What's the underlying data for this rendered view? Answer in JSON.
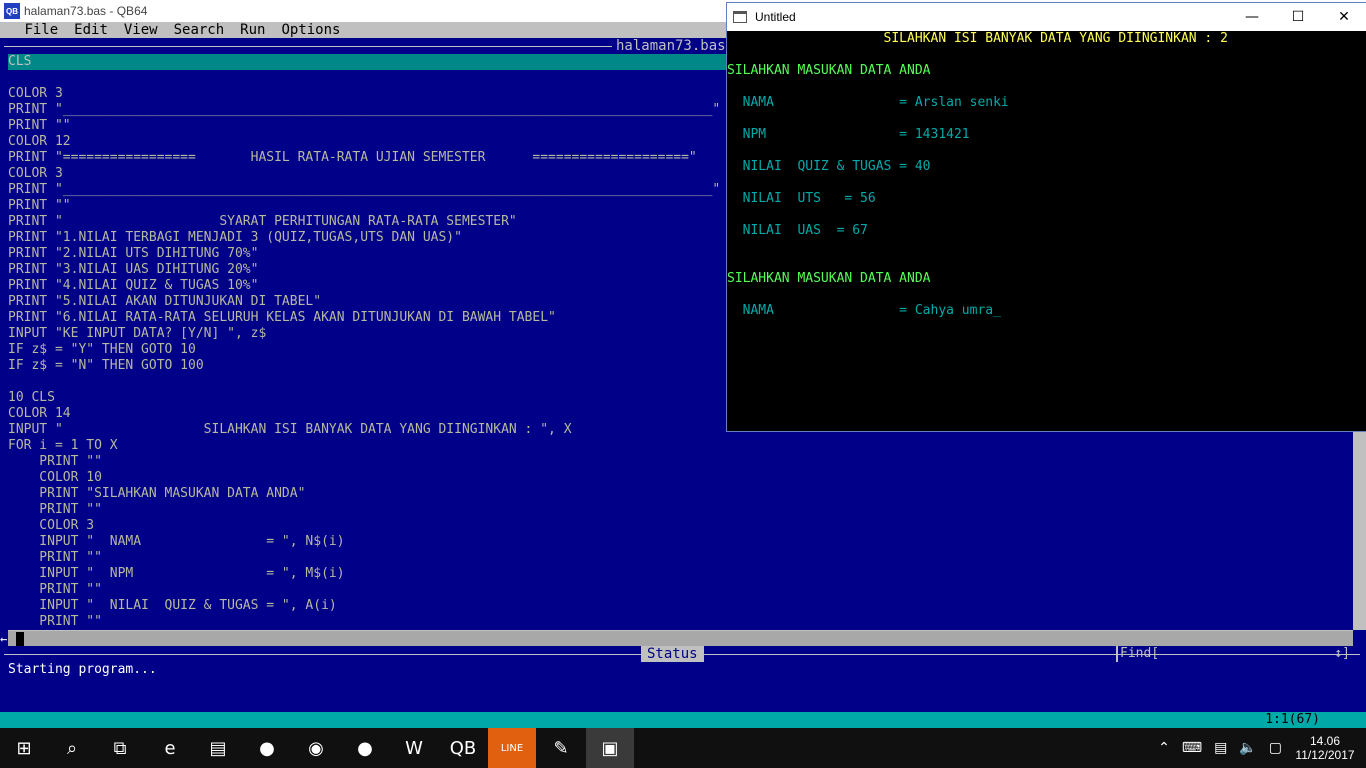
{
  "qb64": {
    "title": "halaman73.bas - QB64",
    "menu": [
      "File",
      "Edit",
      "View",
      "Search",
      "Run",
      "Options"
    ],
    "file_tab": "halaman73.bas*",
    "code_lines": [
      "CLS",
      "",
      "COLOR 3",
      "PRINT \"___________________________________________________________________________________\"",
      "PRINT \"\"",
      "COLOR 12",
      "PRINT \"=================       HASIL RATA-RATA UJIAN SEMESTER      ====================\"",
      "COLOR 3",
      "PRINT \"___________________________________________________________________________________\"",
      "PRINT \"\"",
      "PRINT \"                    SYARAT PERHITUNGAN RATA-RATA SEMESTER\"",
      "PRINT \"1.NILAI TERBAGI MENJADI 3 (QUIZ,TUGAS,UTS DAN UAS)\"",
      "PRINT \"2.NILAI UTS DIHITUNG 70%\"",
      "PRINT \"3.NILAI UAS DIHITUNG 20%\"",
      "PRINT \"4.NILAI QUIZ & TUGAS 10%\"",
      "PRINT \"5.NILAI AKAN DITUNJUKAN DI TABEL\"",
      "PRINT \"6.NILAI RATA-RATA SELURUH KELAS AKAN DITUNJUKAN DI BAWAH TABEL\"",
      "INPUT \"KE INPUT DATA? [Y/N] \", z$",
      "IF z$ = \"Y\" THEN GOTO 10",
      "IF z$ = \"N\" THEN GOTO 100",
      "",
      "10 CLS",
      "COLOR 14",
      "INPUT \"                  SILAHKAN ISI BANYAK DATA YANG DIINGINKAN : \", X",
      "FOR i = 1 TO X",
      "    PRINT \"\"",
      "    COLOR 10",
      "    PRINT \"SILAHKAN MASUKAN DATA ANDA\"",
      "    PRINT \"\"",
      "    COLOR 3",
      "    INPUT \"  NAMA                = \", N$(i)",
      "    PRINT \"\"",
      "    INPUT \"  NPM                 = \", M$(i)",
      "    PRINT \"\"",
      "    INPUT \"  NILAI  QUIZ & TUGAS = \", A(i)",
      "    PRINT \"\""
    ],
    "status_label": "Status",
    "find_label": "Find[",
    "find_end": "↕]",
    "status_message": "Starting program...",
    "cursor_position": "1:1(67)"
  },
  "output_window": {
    "title": "Untitled",
    "lines": [
      {
        "text": "                    SILAHKAN ISI BANYAK DATA YANG DIINGINKAN : 2",
        "color": "c14"
      },
      {
        "text": "",
        "color": "c3"
      },
      {
        "text": "SILAHKAN MASUKAN DATA ANDA",
        "color": "c10"
      },
      {
        "text": "",
        "color": "c3"
      },
      {
        "text": "  NAMA                = Arslan senki",
        "color": "c3"
      },
      {
        "text": "",
        "color": "c3"
      },
      {
        "text": "  NPM                 = 1431421",
        "color": "c3"
      },
      {
        "text": "",
        "color": "c3"
      },
      {
        "text": "  NILAI  QUIZ & TUGAS = 40",
        "color": "c3"
      },
      {
        "text": "",
        "color": "c3"
      },
      {
        "text": "  NILAI  UTS   = 56",
        "color": "c3"
      },
      {
        "text": "",
        "color": "c3"
      },
      {
        "text": "  NILAI  UAS  = 67",
        "color": "c3"
      },
      {
        "text": "",
        "color": "c3"
      },
      {
        "text": "",
        "color": "c3"
      },
      {
        "text": "SILAHKAN MASUKAN DATA ANDA",
        "color": "c10"
      },
      {
        "text": "",
        "color": "c3"
      },
      {
        "text": "  NAMA                = Cahya umra_",
        "color": "c3"
      }
    ]
  },
  "taskbar": {
    "apps": [
      {
        "name": "start-button",
        "glyph": "⊞"
      },
      {
        "name": "search-icon",
        "glyph": "⌕"
      },
      {
        "name": "task-view-icon",
        "glyph": "⧉"
      },
      {
        "name": "internet-explorer-icon",
        "glyph": "e"
      },
      {
        "name": "file-explorer-icon",
        "glyph": "▤"
      },
      {
        "name": "firefox-icon",
        "glyph": "●"
      },
      {
        "name": "chrome-icon",
        "glyph": "◉"
      },
      {
        "name": "firefox-2-icon",
        "glyph": "●"
      },
      {
        "name": "word-icon",
        "glyph": "W"
      },
      {
        "name": "qb64-icon",
        "glyph": "QB"
      },
      {
        "name": "line-icon",
        "glyph": "LINE"
      },
      {
        "name": "paint-icon",
        "glyph": "✎"
      },
      {
        "name": "console-window-icon",
        "glyph": "▣"
      }
    ],
    "clock_time": "14.06",
    "clock_date": "11/12/2017"
  }
}
